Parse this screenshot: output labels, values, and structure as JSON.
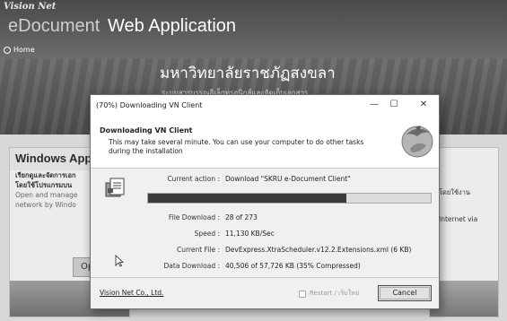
{
  "background": {
    "brand_small": "Vision Net",
    "brand_prefix": "eDocument",
    "brand_title": "Web Application",
    "nav_home": "Home",
    "banner_thai": "มหาวิทยาลัยราชภัฏสงขลา",
    "banner_sub": "ระบบสารบรรณอิเล็กทรอนิกส์และจัดเก็บเอกสาร",
    "left_card": {
      "title": "Windows Appl",
      "lines_bold": [
        "เรียกดูและจัดการเอก",
        "โดยใช้โปรแกรมบน"
      ],
      "lines": [
        "Open and manage",
        "network by Windo"
      ],
      "button": "Ope"
    },
    "right_card": {
      "lines": [
        "โดยใช้งาน",
        "Internet via"
      ]
    }
  },
  "dialog": {
    "title": "(70%) Downloading VN Client",
    "minimize": "—",
    "maximize": "☐",
    "close": "✕",
    "header_title": "Downloading VN Client",
    "header_desc_1": "This may take several minute. You can use your computer to do other tasks",
    "header_desc_2": "during the installation",
    "current_action_label": "Current action :",
    "current_action_value": "Download \"SKRU e-Document Client\"",
    "progress_fraction": 0.7,
    "file_download_label": "File Download :",
    "file_download_value": "28 of 273",
    "speed_label": "Speed :",
    "speed_value": "11,130 KB/Sec",
    "current_file_label": "Current File :",
    "current_file_value": "DevExpress.XtraScheduler.v12.2.Extensions.xml (6 KB)",
    "data_download_label": "Data Download :",
    "data_download_value": "40,506 of 57,726 KB (35% Compressed)",
    "company_link": "Vision Net Co., Ltd.",
    "restart_label": "Restart / เริ่มใหม่",
    "cancel_button": "Cancel"
  }
}
